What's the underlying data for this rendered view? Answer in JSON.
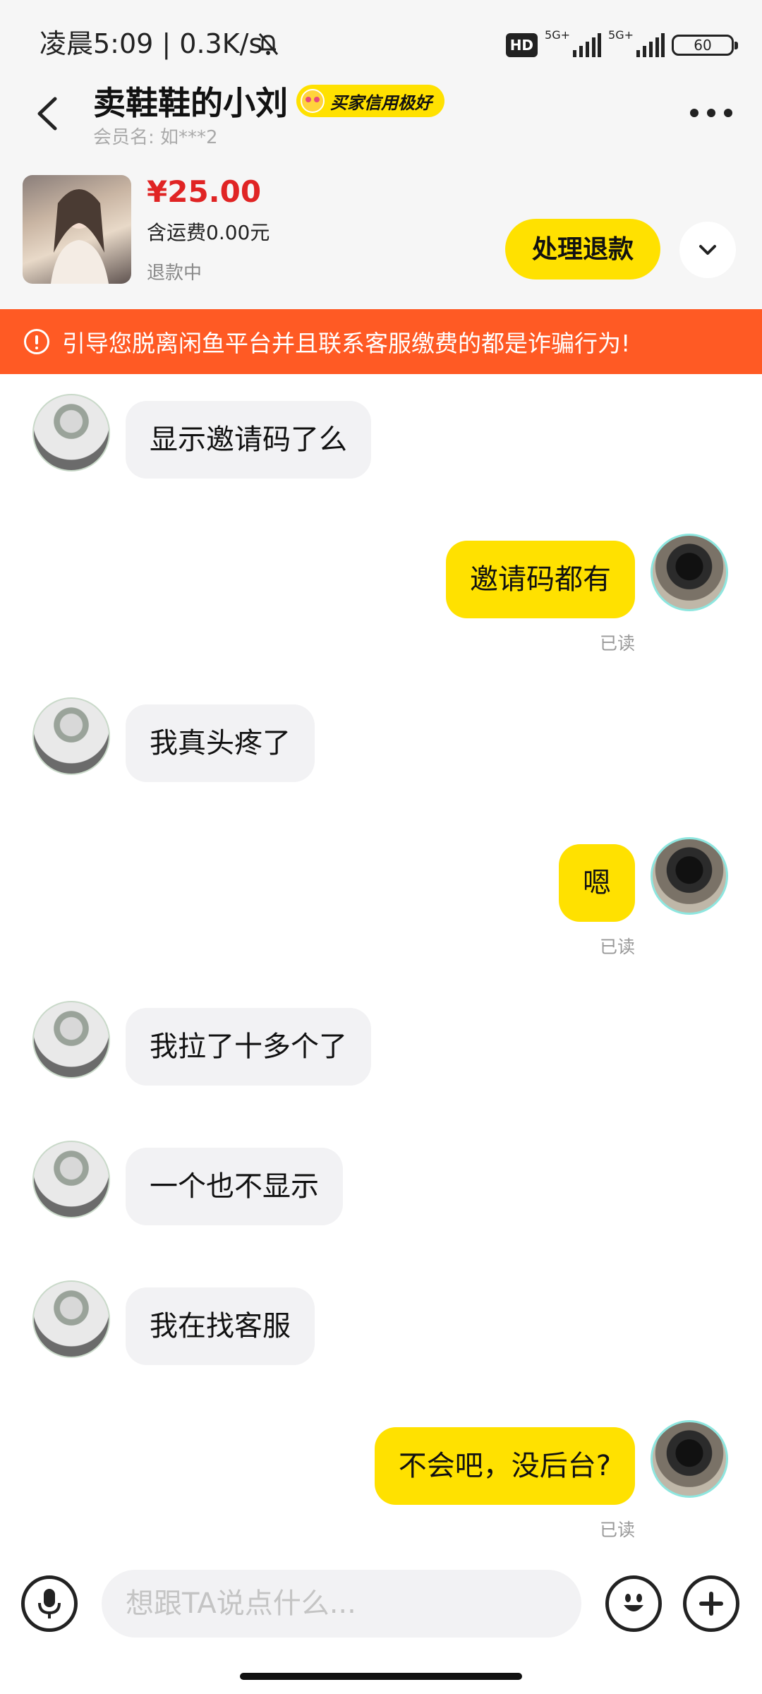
{
  "status_bar": {
    "time_and_speed": "凌晨5:09 | 0.3K/s",
    "hd_label": "HD",
    "net1": "5G+",
    "net2": "5G+",
    "battery": "60"
  },
  "header": {
    "seller_name": "卖鞋鞋的小刘",
    "credit_badge": "买家信用极好",
    "member_name": "会员名: 如***2"
  },
  "product": {
    "price": "¥25.00",
    "shipping": "含运费0.00元",
    "status": "退款中",
    "action_label": "处理退款"
  },
  "warning": {
    "text": "引导您脱离闲鱼平台并且联系客服缴费的都是诈骗行为!"
  },
  "messages": [
    {
      "side": "left",
      "text": "显示邀请码了么"
    },
    {
      "side": "right",
      "text": "邀请码都有",
      "read": "已读"
    },
    {
      "side": "left",
      "text": "我真头疼了"
    },
    {
      "side": "right",
      "text": "嗯",
      "read": "已读"
    },
    {
      "side": "left",
      "text": "我拉了十多个了"
    },
    {
      "side": "left",
      "text": "一个也不显示"
    },
    {
      "side": "left",
      "text": "我在找客服"
    },
    {
      "side": "right",
      "text": "不会吧，没后台?",
      "read": "已读"
    }
  ],
  "input": {
    "placeholder": "想跟TA说点什么..."
  },
  "icons": {
    "back": "back-arrow-icon",
    "more": "more-dots-icon",
    "expand": "chevron-down-icon",
    "warning": "warning-circle-icon",
    "voice": "microphone-icon",
    "emoji": "emoji-icon",
    "plus": "plus-icon",
    "mute": "bell-off-icon"
  },
  "colors": {
    "accent_yellow": "#ffe100",
    "price_red": "#e02424",
    "warning_orange": "#ff5a24"
  }
}
